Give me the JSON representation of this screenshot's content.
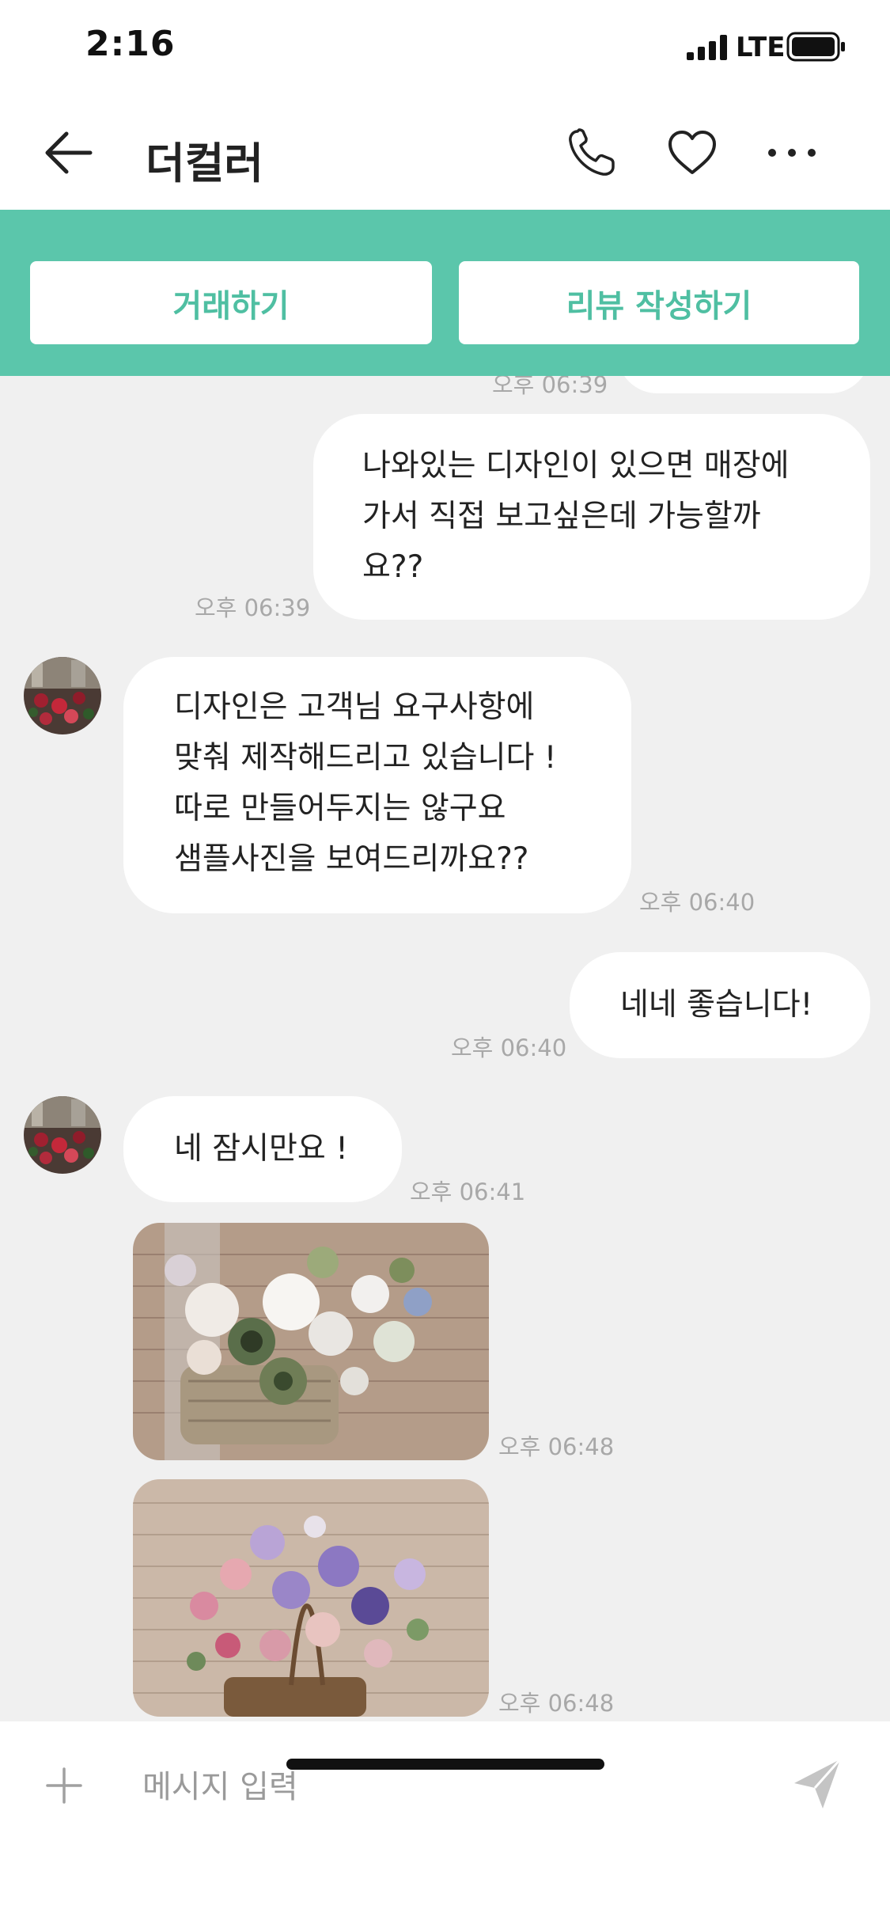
{
  "status_bar": {
    "time": "2:16",
    "network": "LTE"
  },
  "header": {
    "title": "더컬러"
  },
  "actions": {
    "trade_label": "거래하기",
    "review_label": "리뷰 작성하기"
  },
  "messages": [
    {
      "sender": "other",
      "type": "partial",
      "time": "오후 06:39"
    },
    {
      "sender": "me",
      "type": "text",
      "text": "나와있는 디자인이 있으면 매장에\n가서 직접 보고싶은데 가능할까\n요??",
      "time": "오후 06:39"
    },
    {
      "sender": "other",
      "type": "text",
      "text": "디자인은 고객님 요구사항에\n맞춰 제작해드리고 있습니다 !\n따로 만들어두지는 않구요\n샘플사진을 보여드리까요??",
      "time": "오후 06:40"
    },
    {
      "sender": "me",
      "type": "text",
      "text": "네네 좋습니다!",
      "time": "오후 06:40"
    },
    {
      "sender": "other",
      "type": "text",
      "text": "네 잠시만요 !",
      "time": "오후 06:41"
    },
    {
      "sender": "other",
      "type": "image",
      "image": "flower-basket-photo",
      "time": "오후 06:48"
    },
    {
      "sender": "other",
      "type": "image",
      "image": "flower-basket-photo",
      "time": "오후 06:48"
    }
  ],
  "input": {
    "placeholder": "메시지 입력",
    "value": ""
  },
  "icons": {
    "back": "arrow-left-icon",
    "call": "phone-icon",
    "favorite": "heart-icon",
    "more": "more-dots-icon",
    "attach": "plus-icon",
    "send": "paper-plane-icon"
  },
  "colors": {
    "accent": "#5bc6ab",
    "accent_text": "#4fbfa2",
    "chat_background": "#f0f0f0",
    "bubble": "#ffffff",
    "timestamp": "#a8a8a8"
  }
}
